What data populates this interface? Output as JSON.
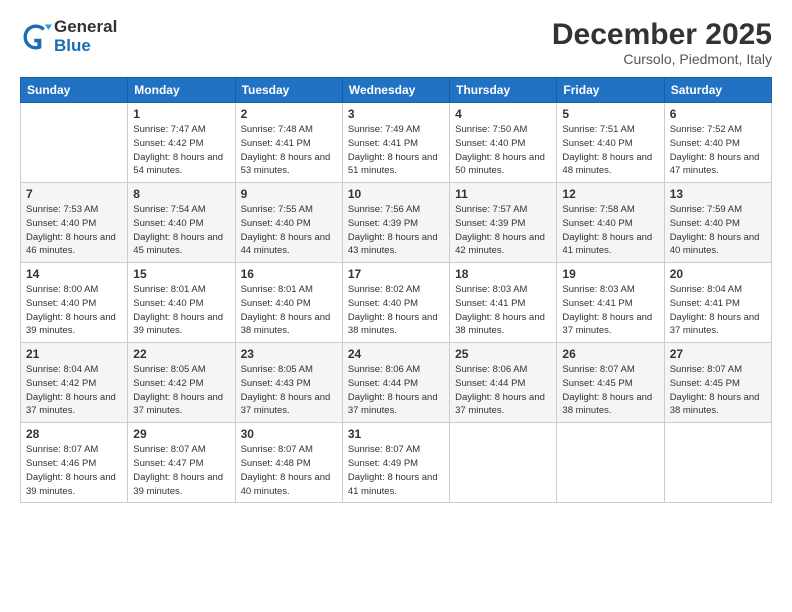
{
  "logo": {
    "general": "General",
    "blue": "Blue"
  },
  "title": {
    "month": "December 2025",
    "location": "Cursolo, Piedmont, Italy"
  },
  "days_of_week": [
    "Sunday",
    "Monday",
    "Tuesday",
    "Wednesday",
    "Thursday",
    "Friday",
    "Saturday"
  ],
  "weeks": [
    [
      {
        "num": "",
        "sunrise": "",
        "sunset": "",
        "daylight": ""
      },
      {
        "num": "1",
        "sunrise": "Sunrise: 7:47 AM",
        "sunset": "Sunset: 4:42 PM",
        "daylight": "Daylight: 8 hours and 54 minutes."
      },
      {
        "num": "2",
        "sunrise": "Sunrise: 7:48 AM",
        "sunset": "Sunset: 4:41 PM",
        "daylight": "Daylight: 8 hours and 53 minutes."
      },
      {
        "num": "3",
        "sunrise": "Sunrise: 7:49 AM",
        "sunset": "Sunset: 4:41 PM",
        "daylight": "Daylight: 8 hours and 51 minutes."
      },
      {
        "num": "4",
        "sunrise": "Sunrise: 7:50 AM",
        "sunset": "Sunset: 4:40 PM",
        "daylight": "Daylight: 8 hours and 50 minutes."
      },
      {
        "num": "5",
        "sunrise": "Sunrise: 7:51 AM",
        "sunset": "Sunset: 4:40 PM",
        "daylight": "Daylight: 8 hours and 48 minutes."
      },
      {
        "num": "6",
        "sunrise": "Sunrise: 7:52 AM",
        "sunset": "Sunset: 4:40 PM",
        "daylight": "Daylight: 8 hours and 47 minutes."
      }
    ],
    [
      {
        "num": "7",
        "sunrise": "Sunrise: 7:53 AM",
        "sunset": "Sunset: 4:40 PM",
        "daylight": "Daylight: 8 hours and 46 minutes."
      },
      {
        "num": "8",
        "sunrise": "Sunrise: 7:54 AM",
        "sunset": "Sunset: 4:40 PM",
        "daylight": "Daylight: 8 hours and 45 minutes."
      },
      {
        "num": "9",
        "sunrise": "Sunrise: 7:55 AM",
        "sunset": "Sunset: 4:40 PM",
        "daylight": "Daylight: 8 hours and 44 minutes."
      },
      {
        "num": "10",
        "sunrise": "Sunrise: 7:56 AM",
        "sunset": "Sunset: 4:39 PM",
        "daylight": "Daylight: 8 hours and 43 minutes."
      },
      {
        "num": "11",
        "sunrise": "Sunrise: 7:57 AM",
        "sunset": "Sunset: 4:39 PM",
        "daylight": "Daylight: 8 hours and 42 minutes."
      },
      {
        "num": "12",
        "sunrise": "Sunrise: 7:58 AM",
        "sunset": "Sunset: 4:40 PM",
        "daylight": "Daylight: 8 hours and 41 minutes."
      },
      {
        "num": "13",
        "sunrise": "Sunrise: 7:59 AM",
        "sunset": "Sunset: 4:40 PM",
        "daylight": "Daylight: 8 hours and 40 minutes."
      }
    ],
    [
      {
        "num": "14",
        "sunrise": "Sunrise: 8:00 AM",
        "sunset": "Sunset: 4:40 PM",
        "daylight": "Daylight: 8 hours and 39 minutes."
      },
      {
        "num": "15",
        "sunrise": "Sunrise: 8:01 AM",
        "sunset": "Sunset: 4:40 PM",
        "daylight": "Daylight: 8 hours and 39 minutes."
      },
      {
        "num": "16",
        "sunrise": "Sunrise: 8:01 AM",
        "sunset": "Sunset: 4:40 PM",
        "daylight": "Daylight: 8 hours and 38 minutes."
      },
      {
        "num": "17",
        "sunrise": "Sunrise: 8:02 AM",
        "sunset": "Sunset: 4:40 PM",
        "daylight": "Daylight: 8 hours and 38 minutes."
      },
      {
        "num": "18",
        "sunrise": "Sunrise: 8:03 AM",
        "sunset": "Sunset: 4:41 PM",
        "daylight": "Daylight: 8 hours and 38 minutes."
      },
      {
        "num": "19",
        "sunrise": "Sunrise: 8:03 AM",
        "sunset": "Sunset: 4:41 PM",
        "daylight": "Daylight: 8 hours and 37 minutes."
      },
      {
        "num": "20",
        "sunrise": "Sunrise: 8:04 AM",
        "sunset": "Sunset: 4:41 PM",
        "daylight": "Daylight: 8 hours and 37 minutes."
      }
    ],
    [
      {
        "num": "21",
        "sunrise": "Sunrise: 8:04 AM",
        "sunset": "Sunset: 4:42 PM",
        "daylight": "Daylight: 8 hours and 37 minutes."
      },
      {
        "num": "22",
        "sunrise": "Sunrise: 8:05 AM",
        "sunset": "Sunset: 4:42 PM",
        "daylight": "Daylight: 8 hours and 37 minutes."
      },
      {
        "num": "23",
        "sunrise": "Sunrise: 8:05 AM",
        "sunset": "Sunset: 4:43 PM",
        "daylight": "Daylight: 8 hours and 37 minutes."
      },
      {
        "num": "24",
        "sunrise": "Sunrise: 8:06 AM",
        "sunset": "Sunset: 4:44 PM",
        "daylight": "Daylight: 8 hours and 37 minutes."
      },
      {
        "num": "25",
        "sunrise": "Sunrise: 8:06 AM",
        "sunset": "Sunset: 4:44 PM",
        "daylight": "Daylight: 8 hours and 37 minutes."
      },
      {
        "num": "26",
        "sunrise": "Sunrise: 8:07 AM",
        "sunset": "Sunset: 4:45 PM",
        "daylight": "Daylight: 8 hours and 38 minutes."
      },
      {
        "num": "27",
        "sunrise": "Sunrise: 8:07 AM",
        "sunset": "Sunset: 4:45 PM",
        "daylight": "Daylight: 8 hours and 38 minutes."
      }
    ],
    [
      {
        "num": "28",
        "sunrise": "Sunrise: 8:07 AM",
        "sunset": "Sunset: 4:46 PM",
        "daylight": "Daylight: 8 hours and 39 minutes."
      },
      {
        "num": "29",
        "sunrise": "Sunrise: 8:07 AM",
        "sunset": "Sunset: 4:47 PM",
        "daylight": "Daylight: 8 hours and 39 minutes."
      },
      {
        "num": "30",
        "sunrise": "Sunrise: 8:07 AM",
        "sunset": "Sunset: 4:48 PM",
        "daylight": "Daylight: 8 hours and 40 minutes."
      },
      {
        "num": "31",
        "sunrise": "Sunrise: 8:07 AM",
        "sunset": "Sunset: 4:49 PM",
        "daylight": "Daylight: 8 hours and 41 minutes."
      },
      {
        "num": "",
        "sunrise": "",
        "sunset": "",
        "daylight": ""
      },
      {
        "num": "",
        "sunrise": "",
        "sunset": "",
        "daylight": ""
      },
      {
        "num": "",
        "sunrise": "",
        "sunset": "",
        "daylight": ""
      }
    ]
  ]
}
